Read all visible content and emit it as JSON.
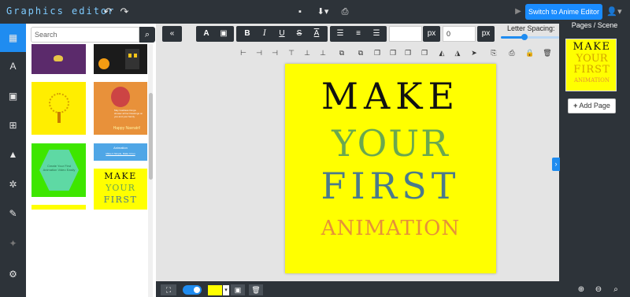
{
  "app": {
    "title": "Graphics editor"
  },
  "toolbar_top": {
    "undo_icon": "undo-icon",
    "redo_icon": "redo-icon",
    "save_icon": "save-icon",
    "download_icon": "download-icon",
    "print_icon": "print-icon",
    "switch_label": "Switch to Anime Editor",
    "user_icon": "user-icon"
  },
  "sidebar": {
    "items": [
      {
        "name": "templates",
        "icon": "templates-icon",
        "glyph": "▦",
        "active": true
      },
      {
        "name": "text",
        "icon": "text-icon",
        "glyph": "A"
      },
      {
        "name": "image",
        "icon": "image-icon",
        "glyph": "▣"
      },
      {
        "name": "elements",
        "icon": "elements-icon",
        "glyph": "⊞"
      },
      {
        "name": "shapes",
        "icon": "shapes-icon",
        "glyph": "▲"
      },
      {
        "name": "connect",
        "icon": "connect-icon",
        "glyph": "✲"
      },
      {
        "name": "brush",
        "icon": "brush-icon",
        "glyph": "✎"
      },
      {
        "name": "magic",
        "icon": "magic-icon",
        "glyph": "✦"
      },
      {
        "name": "settings",
        "icon": "settings-icon",
        "glyph": "⚙"
      }
    ]
  },
  "templates": {
    "search_placeholder": "Search",
    "thumb5_text": "Create Your First Animation Video Easily",
    "thumb4_line1": "May Goddess Durga shower all her blessings on you and your family.",
    "thumb4_line2": "Happy Navratri!",
    "thumb6_line1": "Animation",
    "thumb6_line2": "Make It Simple, Make It Fun",
    "thumb8_lines": [
      "MAKE",
      "YOUR",
      "FIRST"
    ]
  },
  "format_toolbar": {
    "font_size_value": "",
    "font_size_unit": "px",
    "letter_spacing_value": "0",
    "letter_spacing_unit": "px",
    "letter_spacing_label": "Letter Spacing:",
    "letter_spacing_percent": 0.4
  },
  "canvas": {
    "background": "#ffff00",
    "lines": [
      {
        "text": "MAKE",
        "color": "#111111"
      },
      {
        "text": "YOUR",
        "color": "#6aa84f"
      },
      {
        "text": "FIRST",
        "color": "#4a7a8c"
      },
      {
        "text": "ANIMATION",
        "color": "#e69138"
      }
    ]
  },
  "pages": {
    "title": "Pages / Scene",
    "add_label": "Add Page",
    "thumb_lines": [
      "MAKE",
      "YOUR",
      "FIRST",
      "ANIMATION"
    ]
  },
  "bottom": {
    "fullscreen_icon": "fullscreen-icon",
    "toggle_on": true,
    "color_swatch": "#ffff00",
    "bg_image_icon": "background-image-icon",
    "delete_icon": "trash-icon",
    "zoom_in_icon": "zoom-in-icon",
    "zoom_out_icon": "zoom-out-icon",
    "zoom_fit_icon": "zoom-fit-icon"
  },
  "colors": {
    "accent": "#1f8cf0",
    "dark": "#2d3339",
    "canvas_bg": "#ffff00"
  }
}
